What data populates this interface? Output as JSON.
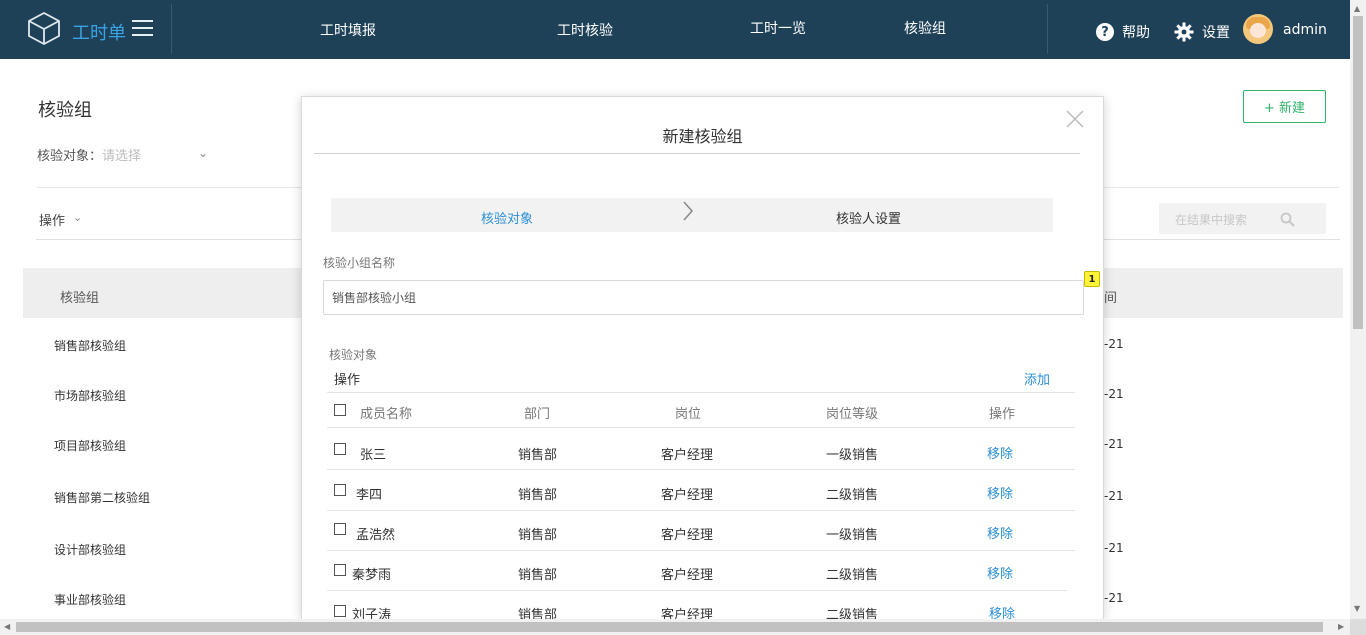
{
  "app": {
    "brand": "工时单",
    "nav": [
      "工时填报",
      "工时核验",
      "工时一览",
      "核验组"
    ],
    "help_label": "帮助",
    "settings_label": "设置",
    "username": "admin"
  },
  "page": {
    "title": "核验组",
    "filter_label": "核验对象：",
    "filter_placeholder": "请选择",
    "ops_label": "操作",
    "new_button": "+ 新建",
    "search_placeholder": "在结果中搜索",
    "table": {
      "col_group": "核验组",
      "col_time_partial": "间",
      "rows": [
        {
          "name": "销售部核验组",
          "date_partial": "-21"
        },
        {
          "name": "市场部核验组",
          "date_partial": "-21"
        },
        {
          "name": "项目部核验组",
          "date_partial": "-21"
        },
        {
          "name": "销售部第二核验组",
          "date_partial": "-21"
        },
        {
          "name": "设计部核验组",
          "date_partial": "-21"
        },
        {
          "name": "事业部核验组",
          "date_partial": "-21"
        }
      ]
    }
  },
  "modal": {
    "title": "新建核验组",
    "steps": [
      "核验对象",
      "核验人设置"
    ],
    "group_name_label": "核验小组名称",
    "group_name_value": "销售部核验小组",
    "badge": "1",
    "target_label": "核验对象",
    "ops_label": "操作",
    "add_label": "添加",
    "columns": [
      "成员名称",
      "部门",
      "岗位",
      "岗位等级",
      "操作"
    ],
    "members": [
      {
        "name": "张三",
        "dept": "销售部",
        "post": "客户经理",
        "level": "一级销售",
        "action": "移除"
      },
      {
        "name": "李四",
        "dept": "销售部",
        "post": "客户经理",
        "level": "二级销售",
        "action": "移除"
      },
      {
        "name": "孟浩然",
        "dept": "销售部",
        "post": "客户经理",
        "level": "一级销售",
        "action": "移除"
      },
      {
        "name": "秦梦雨",
        "dept": "销售部",
        "post": "客户经理",
        "level": "二级销售",
        "action": "移除"
      },
      {
        "name": "刘子涛",
        "dept": "销售部",
        "post": "客户经理",
        "level": "二级销售",
        "action": "移除"
      }
    ]
  },
  "colors": {
    "topbar": "#1f4158",
    "accent_blue": "#2b8fd6",
    "accent_green": "#2fb46a"
  }
}
